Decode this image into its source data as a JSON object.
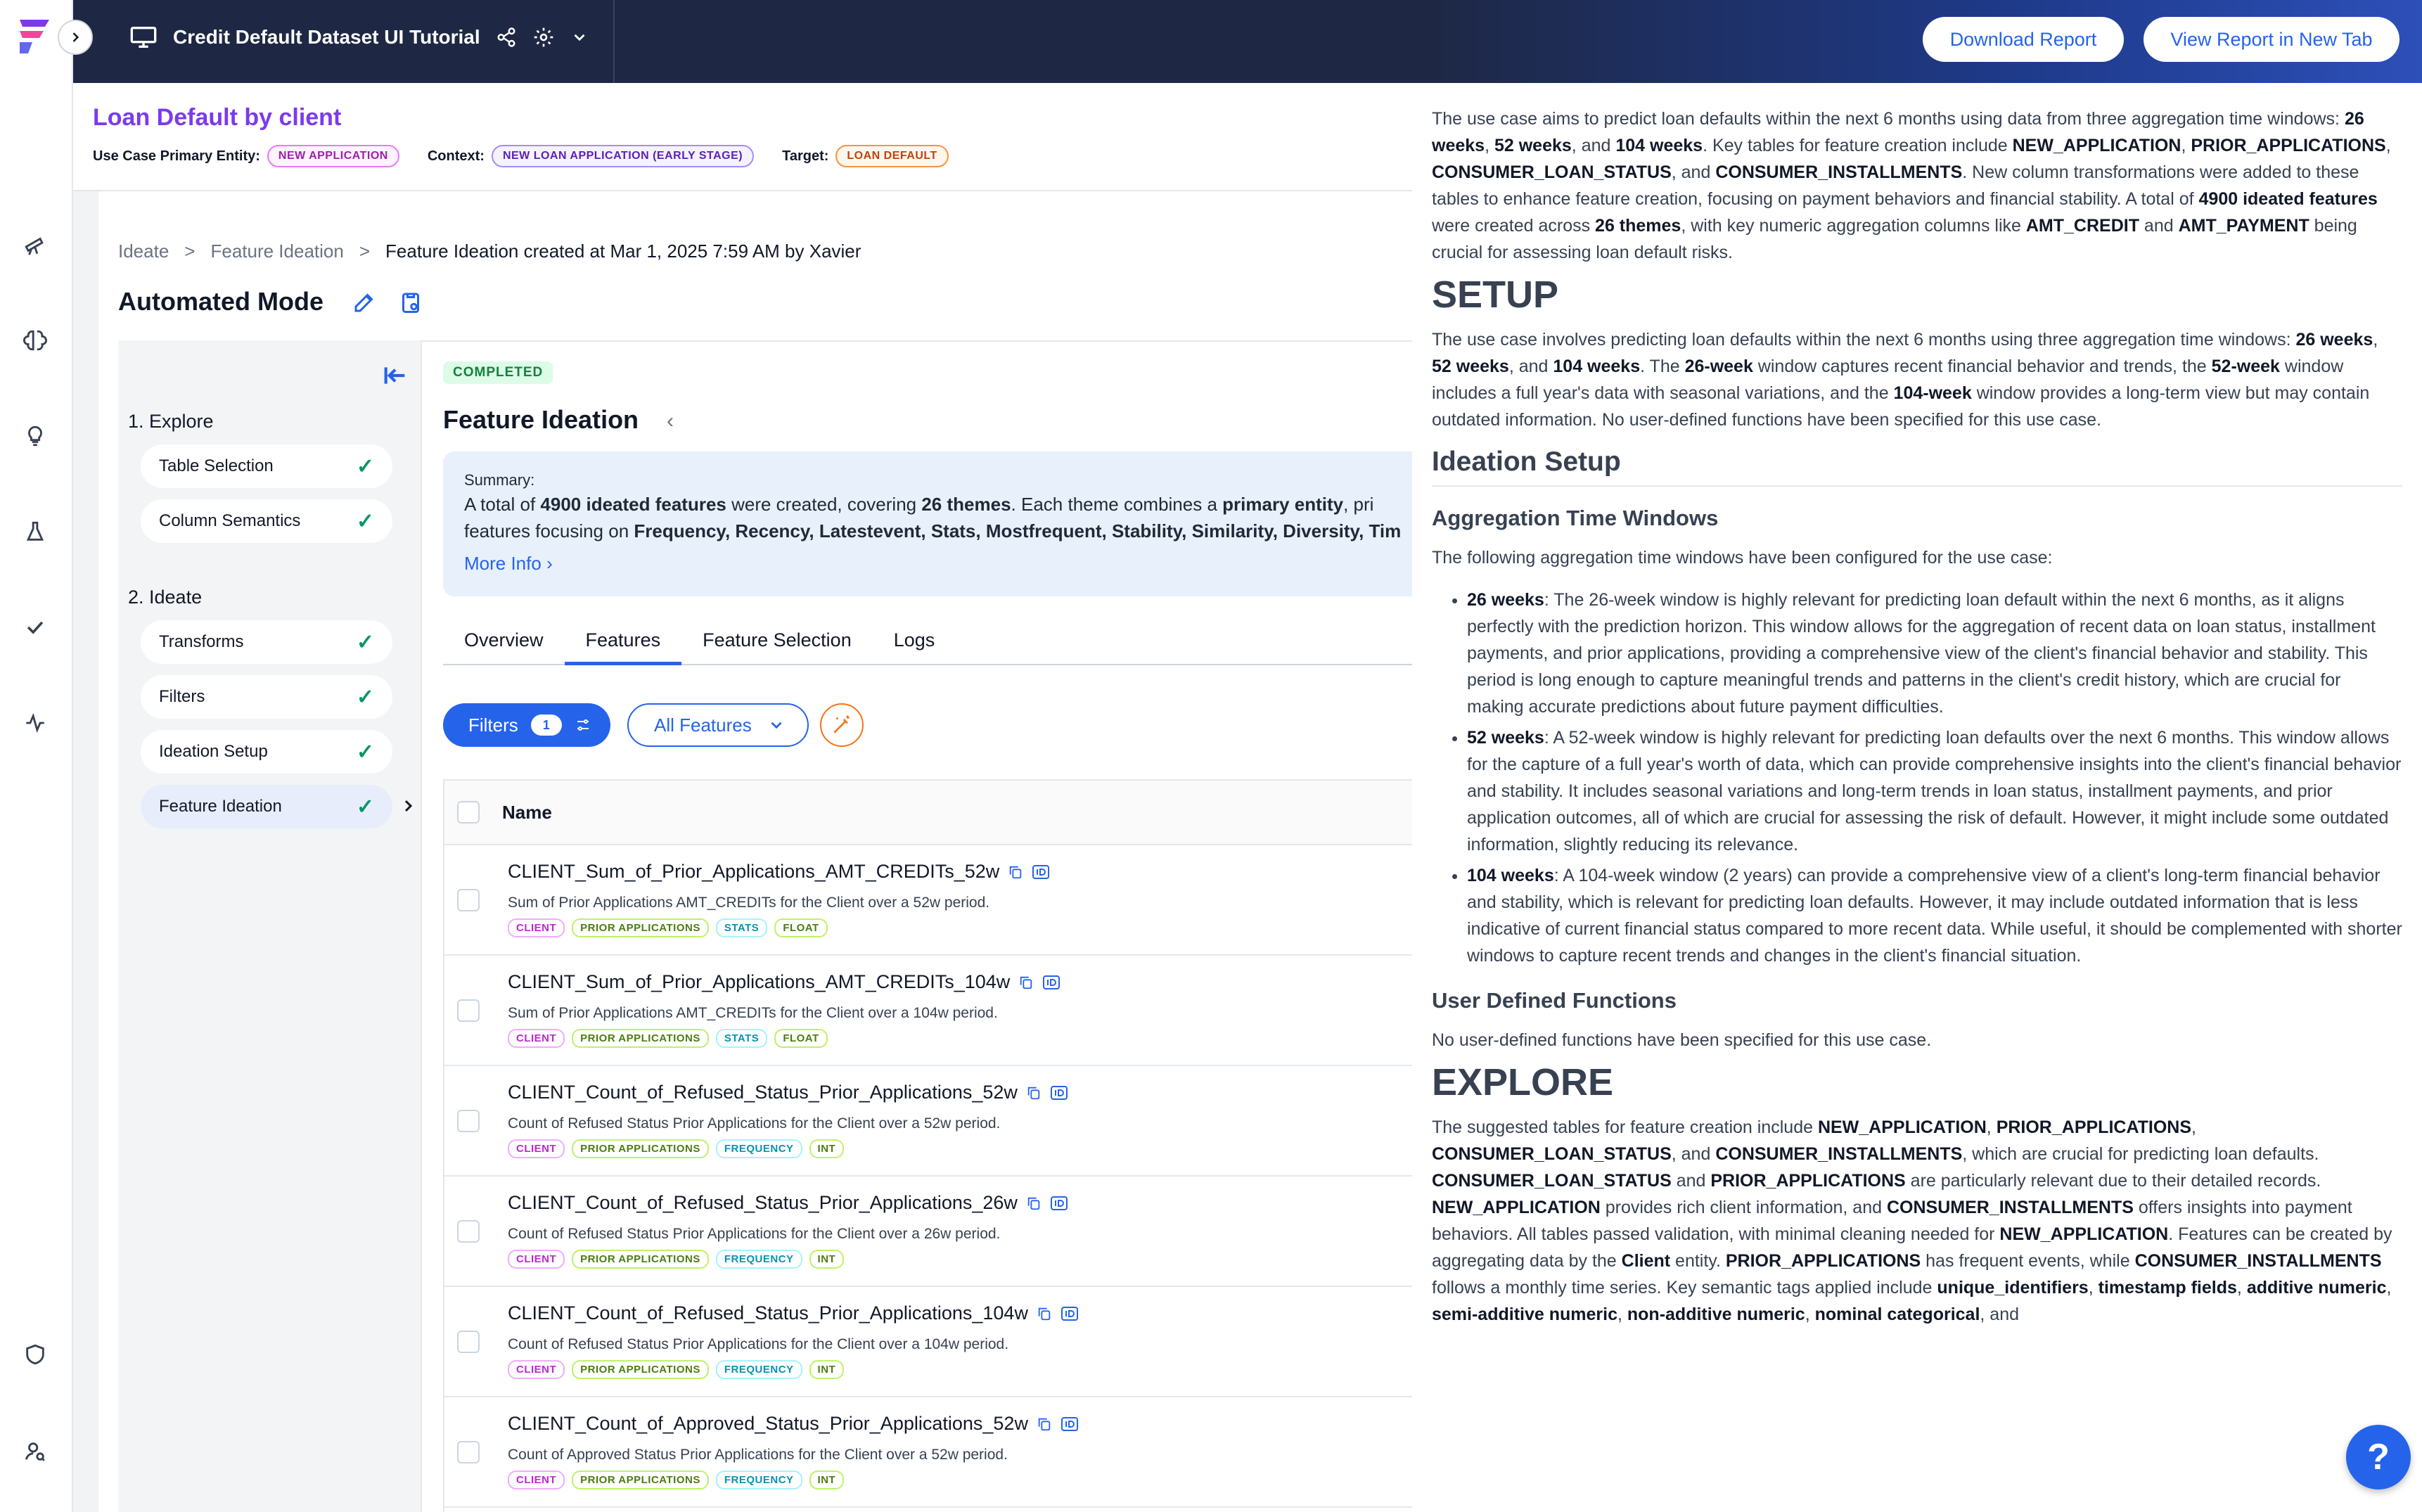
{
  "topbar": {
    "title": "Credit Default Dataset UI Tutorial"
  },
  "header": {
    "title": "Loan Default by client",
    "entity_label": "Use Case Primary Entity:",
    "entity_value": "NEW APPLICATION",
    "context_label": "Context:",
    "context_value": "NEW LOAN APPLICATION (EARLY STAGE)",
    "target_label": "Target:",
    "target_value": "LOAN DEFAULT"
  },
  "breadcrumb": [
    "Ideate",
    ">",
    "Feature Ideation",
    ">",
    "Feature Ideation created at Mar 1, 2025 7:59 AM by Xavier"
  ],
  "mode_title": "Automated Mode",
  "steps": {
    "explore_header": "1. Explore",
    "explore_items": [
      "Table Selection",
      "Column Semantics"
    ],
    "ideate_header": "2. Ideate",
    "ideate_items": [
      "Transforms",
      "Filters",
      "Ideation Setup",
      "Feature Ideation"
    ]
  },
  "main": {
    "status": "COMPLETED",
    "title": "Feature Ideation",
    "summary_label": "Summary:",
    "summary_1a": "A total of ",
    "summary_1b": "4900 ideated features",
    "summary_1c": " were created, covering ",
    "summary_1d": "26 themes",
    "summary_1e": ". Each theme combines a ",
    "summary_1f": "primary entity",
    "summary_1g": ", pri",
    "summary_2a": "features focusing on ",
    "summary_2b": "Frequency, Recency, Latestevent, Stats, Mostfrequent, Stability, Similarity, Diversity, Tim",
    "more_info": "More Info",
    "tabs": [
      "Overview",
      "Features",
      "Feature Selection",
      "Logs"
    ],
    "filters_label": "Filters",
    "filters_count": "1",
    "all_features_label": "All Features",
    "column_name": "Name"
  },
  "features": [
    {
      "name": "CLIENT_Sum_of_Prior_Applications_AMT_CREDITs_52w",
      "desc": "Sum of Prior Applications AMT_CREDITs for the Client over a 52w period.",
      "tags": [
        "CLIENT",
        "PRIOR APPLICATIONS",
        "STATS",
        "FLOAT"
      ]
    },
    {
      "name": "CLIENT_Sum_of_Prior_Applications_AMT_CREDITs_104w",
      "desc": "Sum of Prior Applications AMT_CREDITs for the Client over a 104w period.",
      "tags": [
        "CLIENT",
        "PRIOR APPLICATIONS",
        "STATS",
        "FLOAT"
      ]
    },
    {
      "name": "CLIENT_Count_of_Refused_Status_Prior_Applications_52w",
      "desc": "Count of Refused Status Prior Applications for the Client over a 52w period.",
      "tags": [
        "CLIENT",
        "PRIOR APPLICATIONS",
        "FREQUENCY",
        "INT"
      ]
    },
    {
      "name": "CLIENT_Count_of_Refused_Status_Prior_Applications_26w",
      "desc": "Count of Refused Status Prior Applications for the Client over a 26w period.",
      "tags": [
        "CLIENT",
        "PRIOR APPLICATIONS",
        "FREQUENCY",
        "INT"
      ]
    },
    {
      "name": "CLIENT_Count_of_Refused_Status_Prior_Applications_104w",
      "desc": "Count of Refused Status Prior Applications for the Client over a 104w period.",
      "tags": [
        "CLIENT",
        "PRIOR APPLICATIONS",
        "FREQUENCY",
        "INT"
      ]
    },
    {
      "name": "CLIENT_Count_of_Approved_Status_Prior_Applications_52w",
      "desc": "Count of Approved Status Prior Applications for the Client over a 52w period.",
      "tags": [
        "CLIENT",
        "PRIOR APPLICATIONS",
        "FREQUENCY",
        "INT"
      ]
    }
  ],
  "panel": {
    "download_label": "Download Report",
    "view_label": "View Report in New Tab",
    "intro": [
      {
        "t": "The use case aims to predict loan defaults within the next 6 months using data from three aggregation time windows: "
      },
      {
        "t": "26 weeks",
        "b": true
      },
      {
        "t": ", "
      },
      {
        "t": "52 weeks",
        "b": true
      },
      {
        "t": ", and "
      },
      {
        "t": "104 weeks",
        "b": true
      },
      {
        "t": ". Key tables for feature creation include "
      },
      {
        "t": "NEW_APPLICATION",
        "b": true
      },
      {
        "t": ", "
      },
      {
        "t": "PRIOR_APPLICATIONS",
        "b": true
      },
      {
        "t": ", "
      },
      {
        "t": "CONSUMER_LOAN_STATUS",
        "b": true
      },
      {
        "t": ", and "
      },
      {
        "t": "CONSUMER_INSTALLMENTS",
        "b": true
      },
      {
        "t": ". New column transformations were added to these tables to enhance feature creation, focusing on payment behaviors and financial stability. A total of "
      },
      {
        "t": "4900 ideated features",
        "b": true
      },
      {
        "t": " were created across "
      },
      {
        "t": "26 themes",
        "b": true
      },
      {
        "t": ", with key numeric aggregation columns like "
      },
      {
        "t": "AMT_CREDIT",
        "b": true
      },
      {
        "t": " and "
      },
      {
        "t": "AMT_PAYMENT",
        "b": true
      },
      {
        "t": " being crucial for assessing loan default risks."
      }
    ],
    "setup_heading": "SETUP",
    "setup_text": [
      {
        "t": "The use case involves predicting loan defaults within the next 6 months using three aggregation time windows: "
      },
      {
        "t": "26 weeks",
        "b": true
      },
      {
        "t": ", "
      },
      {
        "t": "52 weeks",
        "b": true
      },
      {
        "t": ", and "
      },
      {
        "t": "104 weeks",
        "b": true
      },
      {
        "t": ". The "
      },
      {
        "t": "26-week",
        "b": true
      },
      {
        "t": " window captures recent financial behavior and trends, the "
      },
      {
        "t": "52-week",
        "b": true
      },
      {
        "t": " window includes a full year's data with seasonal variations, and the "
      },
      {
        "t": "104-week",
        "b": true
      },
      {
        "t": " window provides a long-term view but may contain outdated information. No user-defined functions have been specified for this use case."
      }
    ],
    "ideation_setup_heading": "Ideation Setup",
    "agg_heading": "Aggregation Time Windows",
    "agg_intro": "The following aggregation time windows have been configured for the use case:",
    "windows": [
      {
        "label": "26 weeks",
        "text": ": The 26-week window is highly relevant for predicting loan default within the next 6 months, as it aligns perfectly with the prediction horizon. This window allows for the aggregation of recent data on loan status, installment payments, and prior applications, providing a comprehensive view of the client's financial behavior and stability. This period is long enough to capture meaningful trends and patterns in the client's credit history, which are crucial for making accurate predictions about future payment difficulties."
      },
      {
        "label": "52 weeks",
        "text": ": A 52-week window is highly relevant for predicting loan defaults over the next 6 months. This window allows for the capture of a full year's worth of data, which can provide comprehensive insights into the client's financial behavior and stability. It includes seasonal variations and long-term trends in loan status, installment payments, and prior application outcomes, all of which are crucial for assessing the risk of default. However, it might include some outdated information, slightly reducing its relevance."
      },
      {
        "label": "104 weeks",
        "text": ": A 104-week window (2 years) can provide a comprehensive view of a client's long-term financial behavior and stability, which is relevant for predicting loan defaults. However, it may include outdated information that is less indicative of current financial status compared to more recent data. While useful, it should be complemented with shorter windows to capture recent trends and changes in the client's financial situation."
      }
    ],
    "udf_heading": "User Defined Functions",
    "udf_text": "No user-defined functions have been specified for this use case.",
    "explore_heading": "EXPLORE",
    "explore_text": [
      {
        "t": "The suggested tables for feature creation include "
      },
      {
        "t": "NEW_APPLICATION",
        "b": true
      },
      {
        "t": ", "
      },
      {
        "t": "PRIOR_APPLICATIONS",
        "b": true
      },
      {
        "t": ", "
      },
      {
        "t": "CONSUMER_LOAN_STATUS",
        "b": true
      },
      {
        "t": ", and "
      },
      {
        "t": "CONSUMER_INSTALLMENTS",
        "b": true
      },
      {
        "t": ", which are crucial for predicting loan defaults. "
      },
      {
        "t": "CONSUMER_LOAN_STATUS",
        "b": true
      },
      {
        "t": " and "
      },
      {
        "t": "PRIOR_APPLICATIONS",
        "b": true
      },
      {
        "t": " are particularly relevant due to their detailed records. "
      },
      {
        "t": "NEW_APPLICATION",
        "b": true
      },
      {
        "t": " provides rich client information, and "
      },
      {
        "t": "CONSUMER_INSTALLMENTS",
        "b": true
      },
      {
        "t": " offers insights into payment behaviors. All tables passed validation, with minimal cleaning needed for "
      },
      {
        "t": "NEW_APPLICATION",
        "b": true
      },
      {
        "t": ". Features can be created by aggregating data by the "
      },
      {
        "t": "Client",
        "b": true
      },
      {
        "t": " entity. "
      },
      {
        "t": "PRIOR_APPLICATIONS",
        "b": true
      },
      {
        "t": " has frequent events, while "
      },
      {
        "t": "CONSUMER_INSTALLMENTS",
        "b": true
      },
      {
        "t": " follows a monthly time series. Key semantic tags applied include "
      },
      {
        "t": "unique_identifiers",
        "b": true
      },
      {
        "t": ", "
      },
      {
        "t": "timestamp fields",
        "b": true
      },
      {
        "t": ", "
      },
      {
        "t": "additive numeric",
        "b": true
      },
      {
        "t": ", "
      },
      {
        "t": "semi-additive numeric",
        "b": true
      },
      {
        "t": ", "
      },
      {
        "t": "non-additive numeric",
        "b": true
      },
      {
        "t": ", "
      },
      {
        "t": "nominal categorical",
        "b": true
      },
      {
        "t": ", and"
      }
    ]
  },
  "help": {
    "label": "?"
  }
}
